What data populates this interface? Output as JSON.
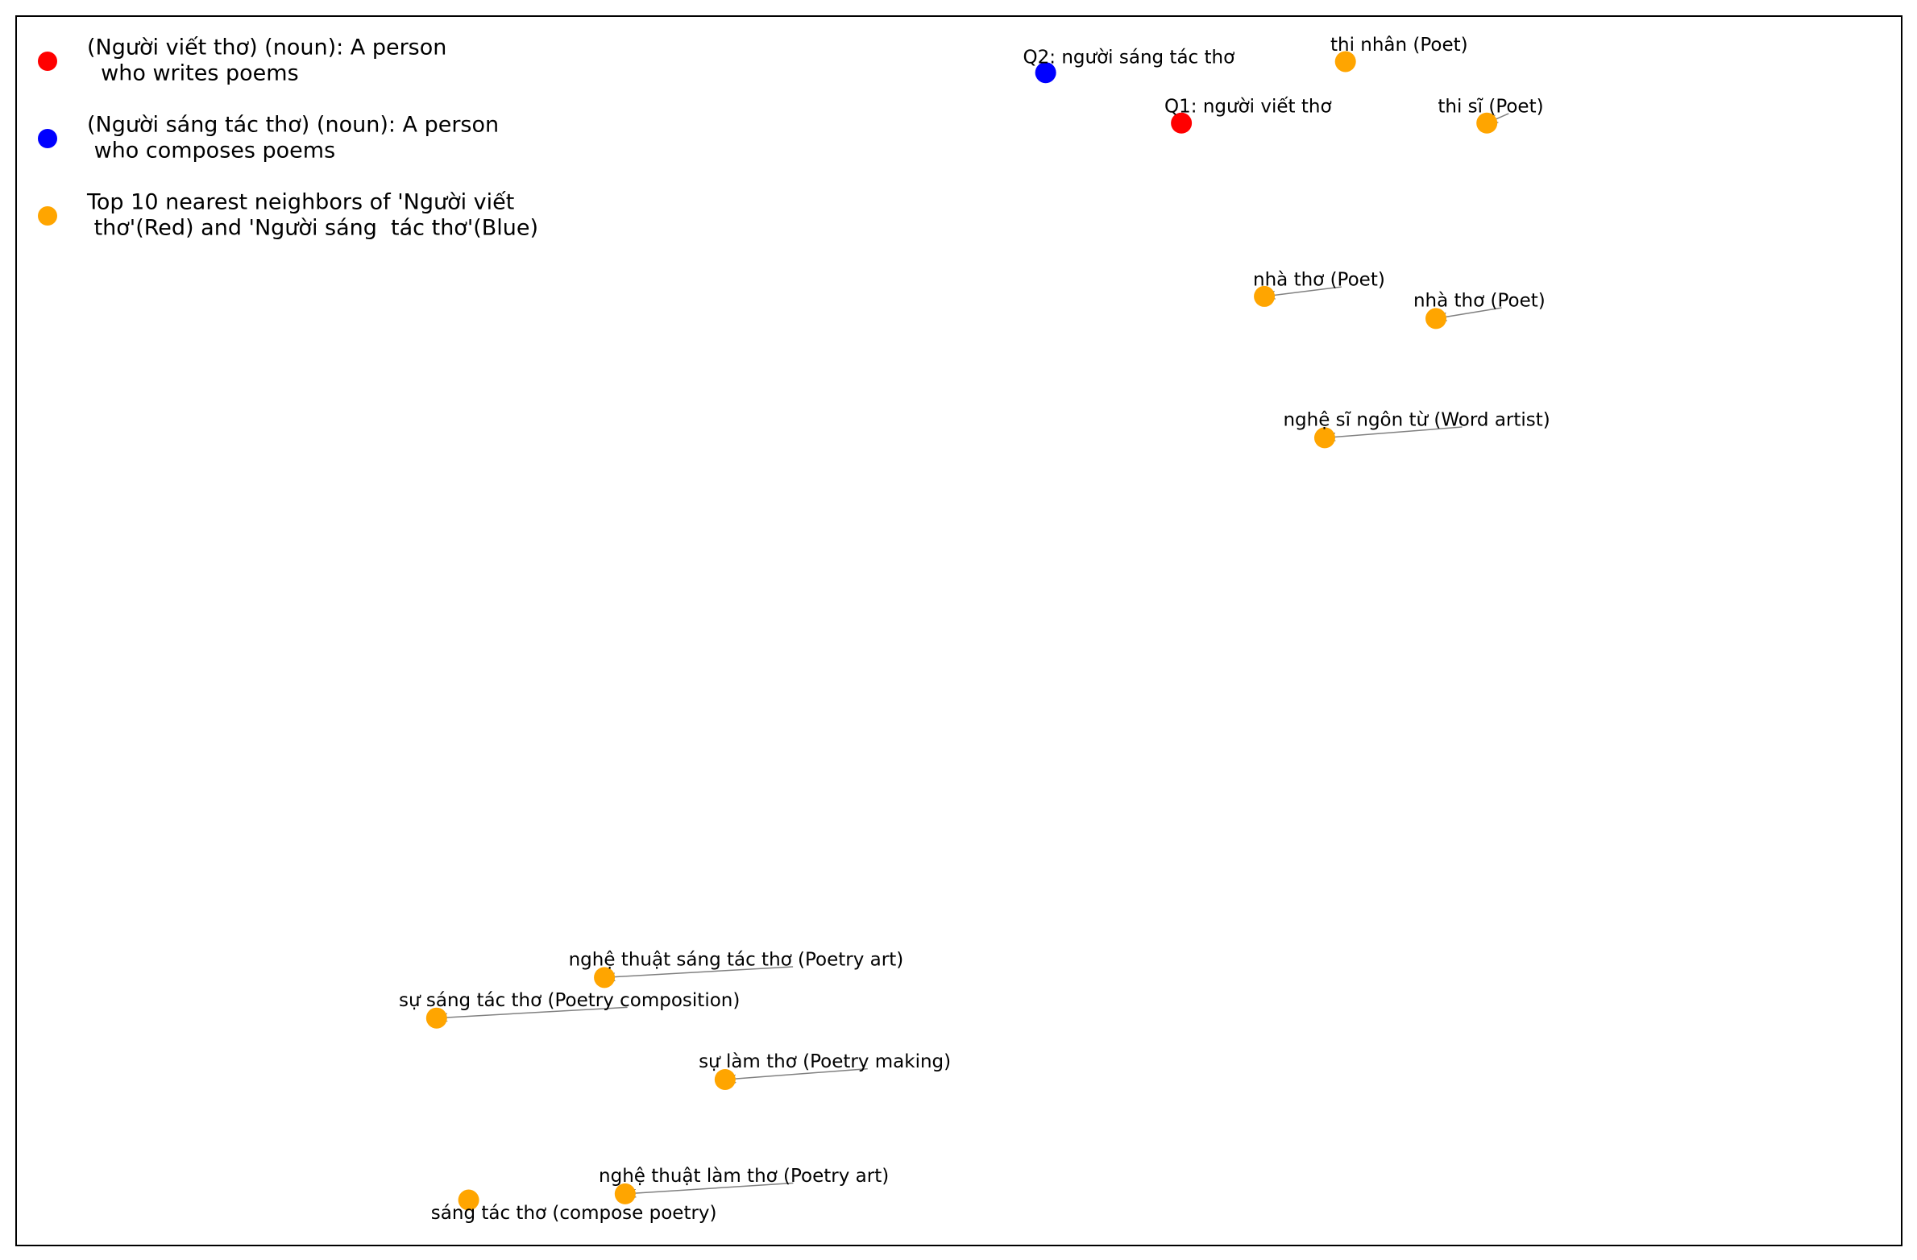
{
  "chart_data": {
    "type": "scatter",
    "title": "",
    "xlabel": "",
    "ylabel": "",
    "xlim": [
      0,
      1
    ],
    "ylim": [
      0,
      1
    ],
    "grid": false,
    "axes_ticks": false,
    "legend_position": "upper-left",
    "colors": {
      "q1": "#ff0000",
      "q2": "#0000ff",
      "neighbor": "#ffa500",
      "arrow": "#808080"
    },
    "legend": [
      {
        "color_key": "q1",
        "lines": [
          "(Người viết thơ) (noun): A person",
          "  who writes poems"
        ]
      },
      {
        "color_key": "q2",
        "lines": [
          "(Người sáng tác thơ) (noun): A person",
          " who composes poems"
        ]
      },
      {
        "color_key": "neighbor",
        "lines": [
          "Top 10 nearest neighbors of 'Người viết",
          " thơ'(Red) and 'Người sáng  tác thơ'(Blue)"
        ]
      }
    ],
    "points": [
      {
        "id": "q2",
        "group": "q2",
        "label": "Q2: người sáng tác thơ",
        "x": 0.546,
        "y": 0.954,
        "label_x": 0.534,
        "label_y": 0.966,
        "arrow": false
      },
      {
        "id": "q1",
        "group": "q1",
        "label": "Q1: người viết thơ",
        "x": 0.618,
        "y": 0.913,
        "label_x": 0.609,
        "label_y": 0.926,
        "arrow": false
      },
      {
        "id": "thi-nhan",
        "group": "neighbor",
        "label": "thi nhân (Poet)",
        "x": 0.705,
        "y": 0.963,
        "label_x": 0.697,
        "label_y": 0.976,
        "arrow": false
      },
      {
        "id": "thi-si",
        "group": "neighbor",
        "label": "thi sĩ (Poet)",
        "x": 0.78,
        "y": 0.913,
        "label_x": 0.754,
        "label_y": 0.926,
        "arrow": true
      },
      {
        "id": "nha-tho-1",
        "group": "neighbor",
        "label": "nhà thơ (Poet)",
        "x": 0.662,
        "y": 0.772,
        "label_x": 0.656,
        "label_y": 0.785,
        "arrow": true
      },
      {
        "id": "nha-tho-2",
        "group": "neighbor",
        "label": "nhà thơ (Poet)",
        "x": 0.753,
        "y": 0.754,
        "label_x": 0.741,
        "label_y": 0.768,
        "arrow": true
      },
      {
        "id": "nghe-si-ngon-tu",
        "group": "neighbor",
        "label": "nghệ sĩ ngôn từ (Word artist)",
        "x": 0.694,
        "y": 0.657,
        "label_x": 0.672,
        "label_y": 0.671,
        "arrow": true
      },
      {
        "id": "nghe-thuat-sang-tac-tho",
        "group": "neighbor",
        "label": "nghệ thuật sáng tác thơ (Poetry art)",
        "x": 0.312,
        "y": 0.218,
        "label_x": 0.293,
        "label_y": 0.232,
        "arrow": true
      },
      {
        "id": "su-sang-tac-tho",
        "group": "neighbor",
        "label": "sự sáng tác thơ (Poetry composition)",
        "x": 0.223,
        "y": 0.185,
        "label_x": 0.203,
        "label_y": 0.199,
        "arrow": true
      },
      {
        "id": "su-lam-tho",
        "group": "neighbor",
        "label": "sự làm thơ (Poetry making)",
        "x": 0.376,
        "y": 0.135,
        "label_x": 0.362,
        "label_y": 0.149,
        "arrow": true
      },
      {
        "id": "nghe-thuat-lam-tho",
        "group": "neighbor",
        "label": "nghệ thuật làm thơ (Poetry art)",
        "x": 0.323,
        "y": 0.042,
        "label_x": 0.309,
        "label_y": 0.056,
        "arrow": true
      },
      {
        "id": "sang-tac-tho",
        "group": "neighbor",
        "label": "sáng tác thơ (compose poetry)",
        "x": 0.24,
        "y": 0.037,
        "label_x": 0.22,
        "label_y": 0.026,
        "arrow": false
      }
    ]
  }
}
